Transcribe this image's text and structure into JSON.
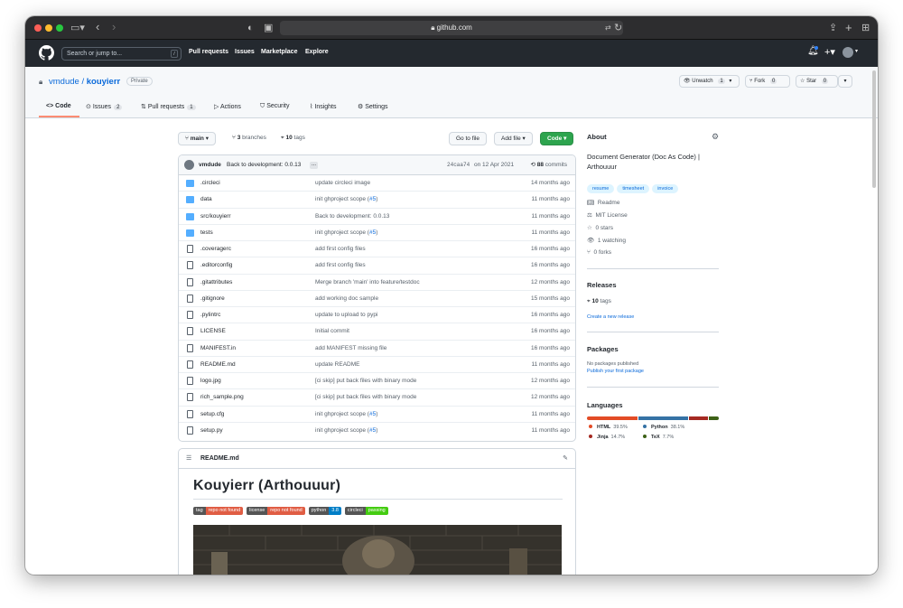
{
  "browser": {
    "url": "github.com"
  },
  "header": {
    "search_placeholder": "Search or jump to...",
    "search_key": "/",
    "nav": [
      "Pull requests",
      "Issues",
      "Marketplace",
      "Explore"
    ]
  },
  "repo": {
    "owner": "vmdude",
    "sep": "/",
    "name": "kouyierr",
    "visibility": "Private",
    "unwatch_label": "Unwatch",
    "unwatch_count": "1",
    "fork_label": "Fork",
    "fork_count": "0",
    "star_label": "Star",
    "star_count": "0"
  },
  "tabs": [
    {
      "label": "Code",
      "count": ""
    },
    {
      "label": "Issues",
      "count": "2"
    },
    {
      "label": "Pull requests",
      "count": "1"
    },
    {
      "label": "Actions",
      "count": ""
    },
    {
      "label": "Security",
      "count": ""
    },
    {
      "label": "Insights",
      "count": ""
    },
    {
      "label": "Settings",
      "count": ""
    }
  ],
  "toolbar": {
    "branch": "main",
    "branches_count": "3",
    "branches_label": "branches",
    "tags_count": "10",
    "tags_label": "tags",
    "goto_file": "Go to file",
    "add_file": "Add file",
    "code": "Code"
  },
  "commit": {
    "author": "vmdude",
    "message": "Back to development: 0.0.13",
    "ellipsis": "...",
    "sha": "24caa74",
    "date": "on 12 Apr 2021",
    "count": "88",
    "count_label": "commits"
  },
  "files": [
    {
      "type": "dir",
      "name": ".circleci",
      "msg": "update circleci image",
      "link": "",
      "tail": "",
      "time": "14 months ago"
    },
    {
      "type": "dir",
      "name": "data",
      "msg": "init ghproject scope (",
      "link": "#5",
      "tail": ")",
      "time": "11 months ago"
    },
    {
      "type": "dir",
      "name": "src/kouyierr",
      "msg": "Back to development: 0.0.13",
      "link": "",
      "tail": "",
      "time": "11 months ago"
    },
    {
      "type": "dir",
      "name": "tests",
      "msg": "init ghproject scope (",
      "link": "#5",
      "tail": ")",
      "time": "11 months ago"
    },
    {
      "type": "file",
      "name": ".coveragerc",
      "msg": "add first config files",
      "link": "",
      "tail": "",
      "time": "16 months ago"
    },
    {
      "type": "file",
      "name": ".editorconfig",
      "msg": "add first config files",
      "link": "",
      "tail": "",
      "time": "16 months ago"
    },
    {
      "type": "file",
      "name": ".gitattributes",
      "msg": "Merge branch 'main' into feature/testdoc",
      "link": "",
      "tail": "",
      "time": "12 months ago"
    },
    {
      "type": "file",
      "name": ".gitignore",
      "msg": "add working doc sample",
      "link": "",
      "tail": "",
      "time": "15 months ago"
    },
    {
      "type": "file",
      "name": ".pylintrc",
      "msg": "update to upload to pypi",
      "link": "",
      "tail": "",
      "time": "16 months ago"
    },
    {
      "type": "file",
      "name": "LICENSE",
      "msg": "Initial commit",
      "link": "",
      "tail": "",
      "time": "16 months ago"
    },
    {
      "type": "file",
      "name": "MANIFEST.in",
      "msg": "add MANIFEST missing file",
      "link": "",
      "tail": "",
      "time": "16 months ago"
    },
    {
      "type": "file",
      "name": "README.md",
      "msg": "update README",
      "link": "",
      "tail": "",
      "time": "11 months ago"
    },
    {
      "type": "file",
      "name": "logo.jpg",
      "msg": "[ci skip] put back files with binary mode",
      "link": "",
      "tail": "",
      "time": "12 months ago"
    },
    {
      "type": "file",
      "name": "rich_sample.png",
      "msg": "[ci skip] put back files with binary mode",
      "link": "",
      "tail": "",
      "time": "12 months ago"
    },
    {
      "type": "file",
      "name": "setup.cfg",
      "msg": "init ghproject scope (",
      "link": "#5",
      "tail": ")",
      "time": "11 months ago"
    },
    {
      "type": "file",
      "name": "setup.py",
      "msg": "init ghproject scope (",
      "link": "#5",
      "tail": ")",
      "time": "11 months ago"
    }
  ],
  "readme": {
    "filename": "README.md",
    "title": "Kouyierr (Arthouuur)",
    "badges": [
      {
        "left": "tag",
        "right": "repo not found",
        "color": "#e05d44"
      },
      {
        "left": "license",
        "right": "repo not found",
        "color": "#e05d44"
      },
      {
        "left": "python",
        "right": "3.8",
        "color": "#007ec6"
      },
      {
        "left": "circleci",
        "right": "passing",
        "color": "#4c1"
      }
    ]
  },
  "about": {
    "heading": "About",
    "description": "Document Generator (Doc As Code) | Arthouuur",
    "topics": [
      "resume",
      "timesheet",
      "invoice"
    ],
    "readme": "Readme",
    "license": "MIT License",
    "stars": "0 stars",
    "watching": "1 watching",
    "forks": "0 forks"
  },
  "releases": {
    "heading": "Releases",
    "tags_count": "10",
    "tags_label": "tags",
    "create_link": "Create a new release"
  },
  "packages": {
    "heading": "Packages",
    "none": "No packages published",
    "publish_link": "Publish your first package"
  },
  "languages": {
    "heading": "Languages",
    "items": [
      {
        "name": "HTML",
        "pct": "39.5%",
        "value": 39.5,
        "color": "#e34c26"
      },
      {
        "name": "Python",
        "pct": "38.1%",
        "value": 38.1,
        "color": "#3572A5"
      },
      {
        "name": "Jinja",
        "pct": "14.7%",
        "value": 14.7,
        "color": "#a52a22"
      },
      {
        "name": "TeX",
        "pct": "7.7%",
        "value": 7.7,
        "color": "#3D6117"
      }
    ]
  }
}
